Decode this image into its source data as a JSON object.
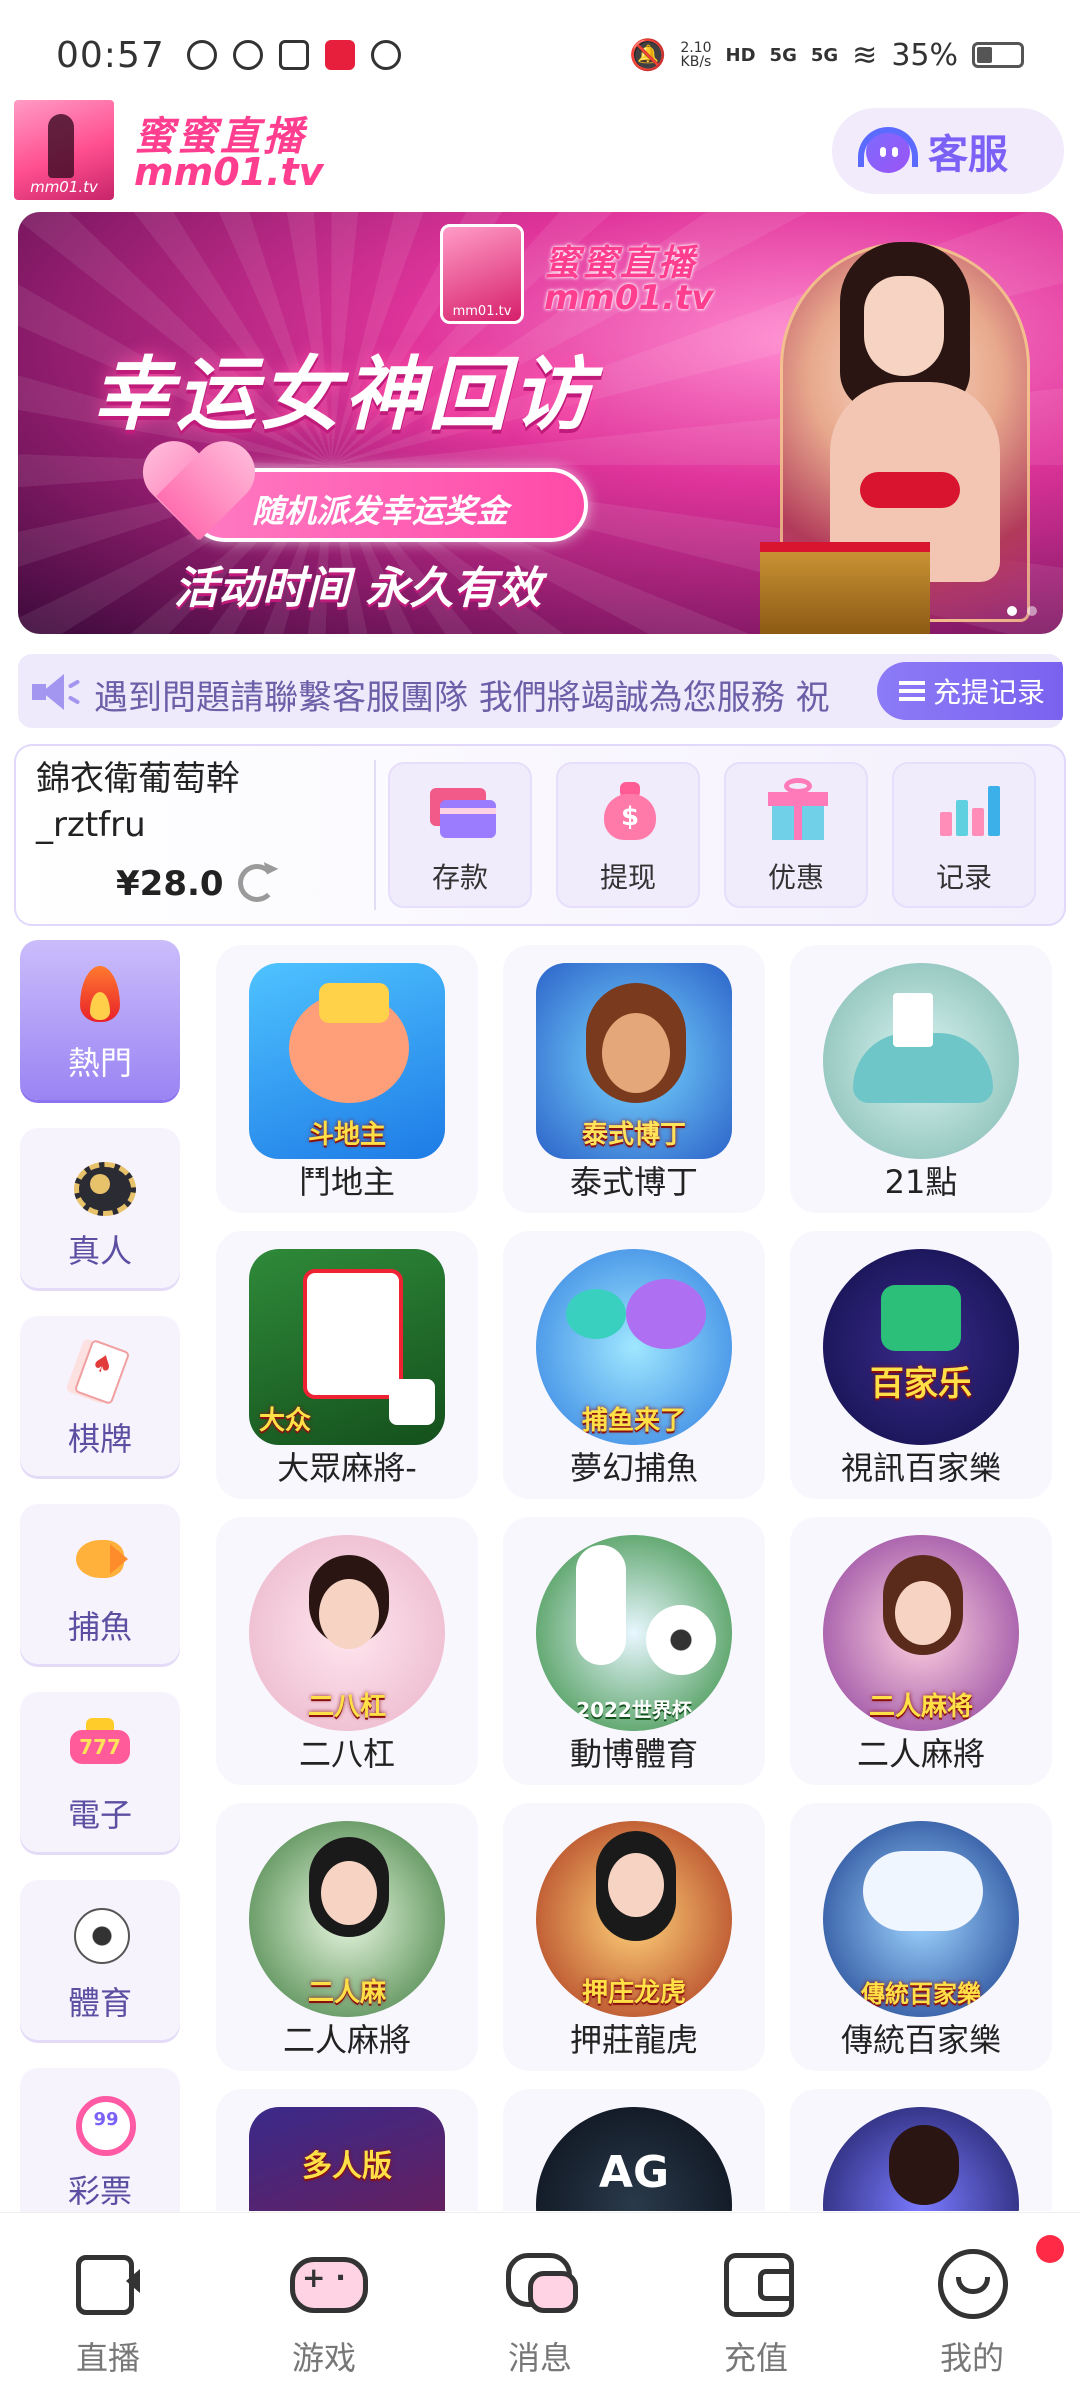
{
  "status_bar": {
    "time": "00:57",
    "net_speed": "2.10",
    "net_unit": "KB/s",
    "hd": "HD",
    "sig1": "5G",
    "sig2": "5G",
    "battery": "35%",
    "battery_level": 0.35
  },
  "header": {
    "logo_caption": "mm01.tv",
    "brand_cn": "蜜蜜直播",
    "brand_en": "mm01.tv",
    "service_label": "客服"
  },
  "banner": {
    "logo_caption": "mm01.tv",
    "brand_cn": "蜜蜜直播",
    "brand_en": "mm01.tv",
    "headline": "幸运女神回访",
    "pill": "随机派发幸运奖金",
    "footer": "活动时间 永久有效"
  },
  "notice": {
    "text": "遇到問題請聯繫客服團隊 我們將竭誠為您服務 祝",
    "records_label": "充提记录"
  },
  "wallet": {
    "username_line1": "錦衣衛葡萄幹",
    "username_line2": "_rztfru",
    "balance": "¥28.0",
    "actions": [
      {
        "label": "存款",
        "icon": "bank-card-icon"
      },
      {
        "label": "提现",
        "icon": "money-bag-icon"
      },
      {
        "label": "优惠",
        "icon": "gift-icon"
      },
      {
        "label": "记录",
        "icon": "bar-chart-icon"
      }
    ]
  },
  "categories": [
    {
      "label": "熱門",
      "icon": "fire-icon",
      "active": true
    },
    {
      "label": "真人",
      "icon": "poker-chip-icon",
      "active": false
    },
    {
      "label": "棋牌",
      "icon": "playing-cards-icon",
      "active": false
    },
    {
      "label": "捕魚",
      "icon": "fish-icon",
      "active": false
    },
    {
      "label": "電子",
      "icon": "slot-machine-icon",
      "active": false
    },
    {
      "label": "體育",
      "icon": "soccer-ball-icon",
      "active": false
    },
    {
      "label": "彩票",
      "icon": "lottery-ball-icon",
      "active": false
    }
  ],
  "games": [
    {
      "name": "鬥地主",
      "art_text": "斗地主"
    },
    {
      "name": "泰式博丁",
      "art_text": "泰式博丁"
    },
    {
      "name": "21點",
      "art_text": ""
    },
    {
      "name": "大眾麻將-",
      "art_text": "大众"
    },
    {
      "name": "夢幻捕魚",
      "art_text": "捕鱼来了"
    },
    {
      "name": "視訊百家樂",
      "art_text": "百家乐"
    },
    {
      "name": "二八杠",
      "art_text": "二八杠"
    },
    {
      "name": "動博體育",
      "art_text": "2022世界杯"
    },
    {
      "name": "二人麻將",
      "art_text": "二人麻将"
    },
    {
      "name": "二人麻將",
      "art_text": "二人麻"
    },
    {
      "name": "押莊龍虎",
      "art_text": "押庄龙虎"
    },
    {
      "name": "傳統百家樂",
      "art_text": "傳統百家樂"
    },
    {
      "name": "",
      "art_text": "多人版"
    },
    {
      "name": "",
      "art_text": "AG"
    },
    {
      "name": "",
      "art_text": ""
    }
  ],
  "bottom_nav": [
    {
      "label": "直播",
      "icon": "video-camera-icon"
    },
    {
      "label": "游戏",
      "icon": "gamepad-icon"
    },
    {
      "label": "消息",
      "icon": "chat-bubbles-icon"
    },
    {
      "label": "充值",
      "icon": "wallet-icon"
    },
    {
      "label": "我的",
      "icon": "smiley-profile-icon",
      "badge": true
    }
  ],
  "colors": {
    "brand_pink": "#ff3e8f",
    "accent_purple": "#7b61f5",
    "badge_red": "#ff2a45"
  }
}
